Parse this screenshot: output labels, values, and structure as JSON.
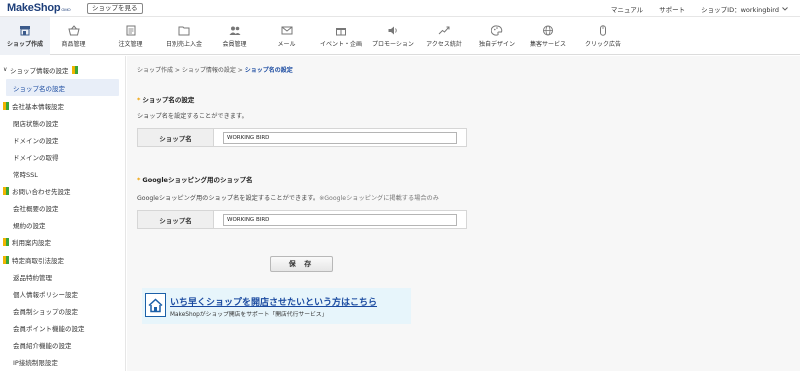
{
  "topbar": {
    "logo": "MakeShop",
    "logo_sub": "GMO",
    "view_shop": "ショップを見る",
    "nav": [
      "マニュアル",
      "サポート"
    ],
    "shop_id": "ショップID：workingbird"
  },
  "navbar": {
    "items": [
      {
        "label": "ショップ作成",
        "icon": "shop-icon",
        "active": true
      },
      {
        "label": "商品管理",
        "icon": "basket-icon"
      },
      {
        "label": "注文管理",
        "icon": "order-list-icon"
      },
      {
        "label": "日別売上入金",
        "icon": "folder-icon"
      },
      {
        "label": "会員管理",
        "icon": "members-icon"
      },
      {
        "label": "メール",
        "icon": "mail-icon"
      },
      {
        "label": "イベント・企画",
        "icon": "gift-icon"
      },
      {
        "label": "プロモーション",
        "icon": "speaker-icon"
      },
      {
        "label": "アクセス統計",
        "icon": "trend-icon"
      },
      {
        "label": "独自デザイン",
        "icon": "palette-icon"
      },
      {
        "label": "集客サービス",
        "icon": "globe-icon"
      },
      {
        "label": "クリック広告",
        "icon": "mouse-icon"
      }
    ]
  },
  "sidebar": {
    "items": [
      {
        "label": "ショップ情報の設定",
        "type": "section",
        "chev": "∨",
        "leaf": true
      },
      {
        "label": "ショップ名の設定",
        "type": "active"
      },
      {
        "label": "会社基本情報設定",
        "type": "section-leaf"
      },
      {
        "label": "閉店状態の設定",
        "type": "sub"
      },
      {
        "label": "ドメインの設定",
        "type": "sub"
      },
      {
        "label": "ドメインの取得",
        "type": "sub"
      },
      {
        "label": "常時SSL",
        "type": "sub"
      },
      {
        "label": "お問い合わせ先設定",
        "type": "section-leaf"
      },
      {
        "label": "会社概要の設定",
        "type": "sub"
      },
      {
        "label": "規約の設定",
        "type": "sub"
      },
      {
        "label": "利用案内設定",
        "type": "section-leaf"
      },
      {
        "label": "特定商取引法設定",
        "type": "section-leaf"
      },
      {
        "label": "返品特約管理",
        "type": "sub"
      },
      {
        "label": "個人情報ポリシー設定",
        "type": "sub"
      },
      {
        "label": "会員制ショップの設定",
        "type": "sub"
      },
      {
        "label": "会員ポイント機能の設定",
        "type": "sub"
      },
      {
        "label": "会員紹介機能の設定",
        "type": "sub"
      },
      {
        "label": "IP接続制限設定",
        "type": "sub"
      }
    ]
  },
  "breadcrumb": {
    "parts": [
      "ショップ作成",
      "ショップ情報の設定"
    ],
    "separator": " > ",
    "current": "ショップ名の設定"
  },
  "section1": {
    "star": "*",
    "title": "ショップ名の設定",
    "desc": "ショップ名を設定することができます。",
    "label": "ショップ名",
    "value": "WORKING BIRD"
  },
  "section2": {
    "star": "*",
    "title": "Googleショッピング用のショップ名",
    "desc": "Googleショッピング用のショップ名を設定することができます。",
    "note": "※Googleショッピングに掲載する場合のみ",
    "label": "ショップ名",
    "value": "WORKING BIRD"
  },
  "save_label": "保 存",
  "banner": {
    "title": "いち早くショップを開店させたいという方はこちら",
    "subtitle": "MakeShopがショップ開店をサポート「開店代行サービス」"
  },
  "colors": {
    "accent": "#1a4aa0",
    "active_bg": "#e8eef8",
    "banner_bg": "#e7f5fb"
  }
}
